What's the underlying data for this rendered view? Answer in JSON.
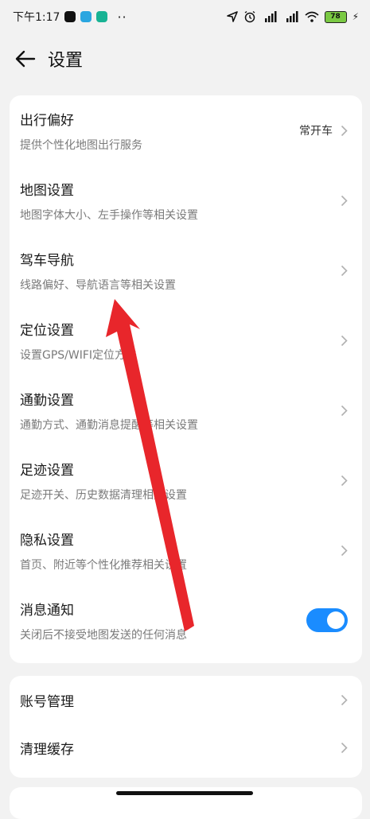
{
  "status_bar": {
    "time": "下午1:17",
    "dots": "··",
    "battery": "78"
  },
  "header": {
    "title": "设置"
  },
  "settings": [
    {
      "title": "出行偏好",
      "subtitle": "提供个性化地图出行服务",
      "value": "常开车"
    },
    {
      "title": "地图设置",
      "subtitle": "地图字体大小、左手操作等相关设置"
    },
    {
      "title": "驾车导航",
      "subtitle": "线路偏好、导航语言等相关设置"
    },
    {
      "title": "定位设置",
      "subtitle": "设置GPS/WIFI定位方法"
    },
    {
      "title": "通勤设置",
      "subtitle": "通勤方式、通勤消息提醒等相关设置"
    },
    {
      "title": "足迹设置",
      "subtitle": "足迹开关、历史数据清理相关设置"
    },
    {
      "title": "隐私设置",
      "subtitle": "首页、附近等个性化推荐相关设置"
    },
    {
      "title": "消息通知",
      "subtitle": "关闭后不接受地图发送的任何消息",
      "toggle_on": true
    }
  ],
  "account_section": [
    {
      "title": "账号管理"
    },
    {
      "title": "清理缓存"
    }
  ],
  "colors": {
    "toggle_on": "#1a8cff",
    "annotation_arrow": "#e8262b",
    "battery": "#7ac943"
  }
}
